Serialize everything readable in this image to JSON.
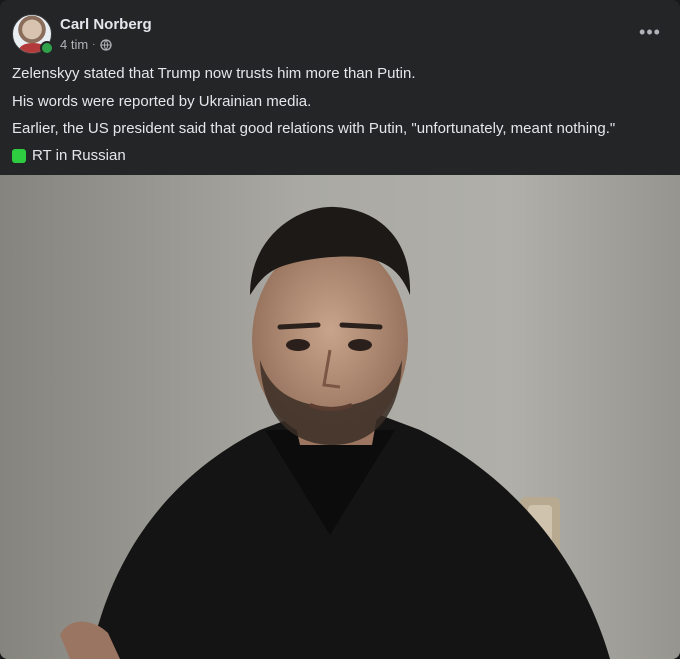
{
  "post": {
    "author": "Carl Norberg",
    "timestamp": "4 tim",
    "separator": "·",
    "privacy_icon": "globe-icon",
    "more_icon": "more-horizontal-icon",
    "more_label": "•••",
    "lines": [
      "Zelenskyy stated that Trump now trusts him more than Putin.",
      "His words were reported by Ukrainian media.",
      "Earlier, the US president said that good relations with Putin, \"unfortunately, meant nothing.\"",
      "RT in Russian"
    ],
    "emoji_icon": "green-square-icon",
    "online_status_color": "#31a24c"
  }
}
